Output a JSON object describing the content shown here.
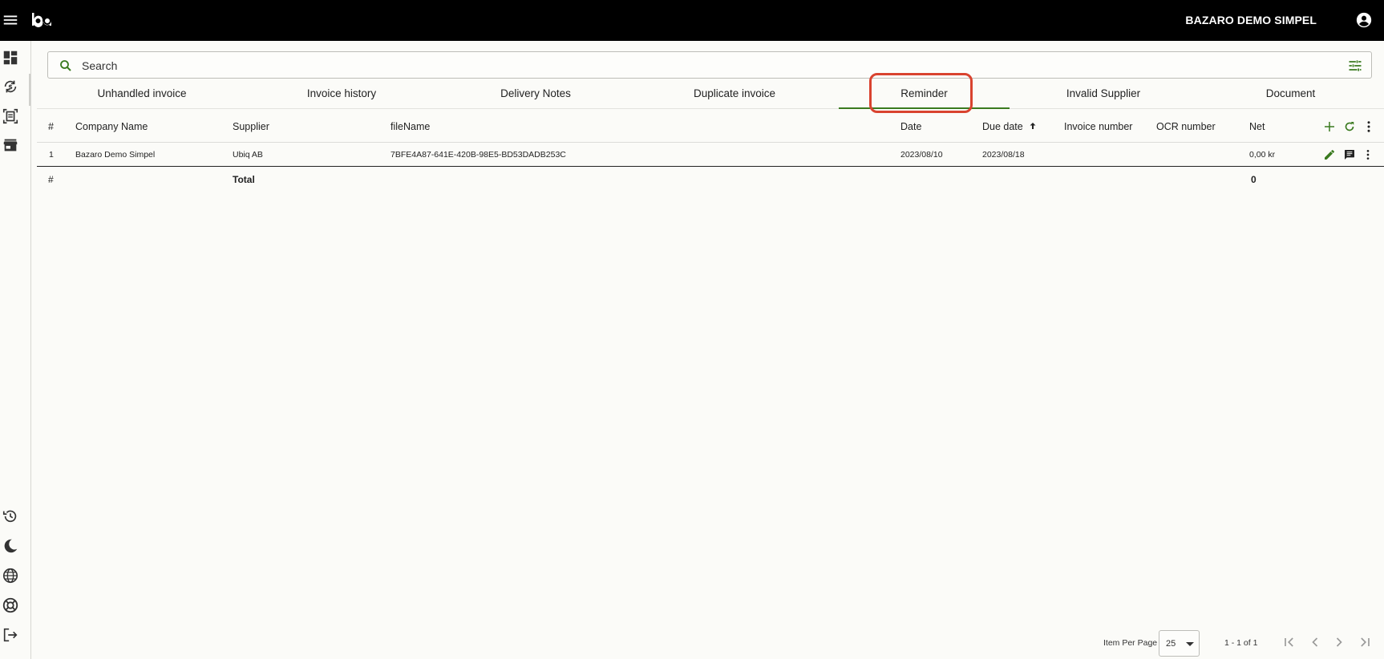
{
  "header": {
    "account_name": "BAZARO DEMO SIMPEL"
  },
  "sidebar": {
    "items": [
      {
        "icon": "dashboard-icon"
      },
      {
        "icon": "currency-exchange-icon"
      },
      {
        "icon": "document-scanner-icon"
      },
      {
        "icon": "store-icon"
      }
    ],
    "bottom_items": [
      {
        "icon": "history-icon"
      },
      {
        "icon": "dark-mode-icon"
      },
      {
        "icon": "language-icon"
      },
      {
        "icon": "support-icon"
      },
      {
        "icon": "logout-icon"
      }
    ]
  },
  "search": {
    "placeholder": "Search"
  },
  "tabs": [
    {
      "label": "Unhandled invoice"
    },
    {
      "label": "Invoice history"
    },
    {
      "label": "Delivery Notes"
    },
    {
      "label": "Duplicate invoice"
    },
    {
      "label": "Reminder",
      "active": true
    },
    {
      "label": "Invalid Supplier"
    },
    {
      "label": "Document"
    }
  ],
  "table": {
    "columns": [
      "#",
      "Company Name",
      "Supplier",
      "fileName",
      "Date",
      "Due date",
      "Invoice number",
      "OCR number",
      "Net"
    ],
    "sort": {
      "column": "Due date",
      "direction": "asc"
    },
    "rows": [
      {
        "index": "1",
        "company_name": "Bazaro Demo Simpel",
        "supplier": "Ubiq AB",
        "file_name": "7BFE4A87-641E-420B-98E5-BD53DADB253C",
        "date": "2023/08/10",
        "due_date": "2023/08/18",
        "invoice_number": "",
        "ocr_number": "",
        "net": "0,00 kr"
      }
    ],
    "totals": {
      "index": "#",
      "label": "Total",
      "net": "0"
    }
  },
  "pagination": {
    "items_per_page_label": "Item Per Page",
    "items_per_page": "25",
    "range": "1 - 1 of 1"
  },
  "colors": {
    "accent": "#3a7a1f",
    "highlight": "#d9432f",
    "topbar": "#000000"
  }
}
